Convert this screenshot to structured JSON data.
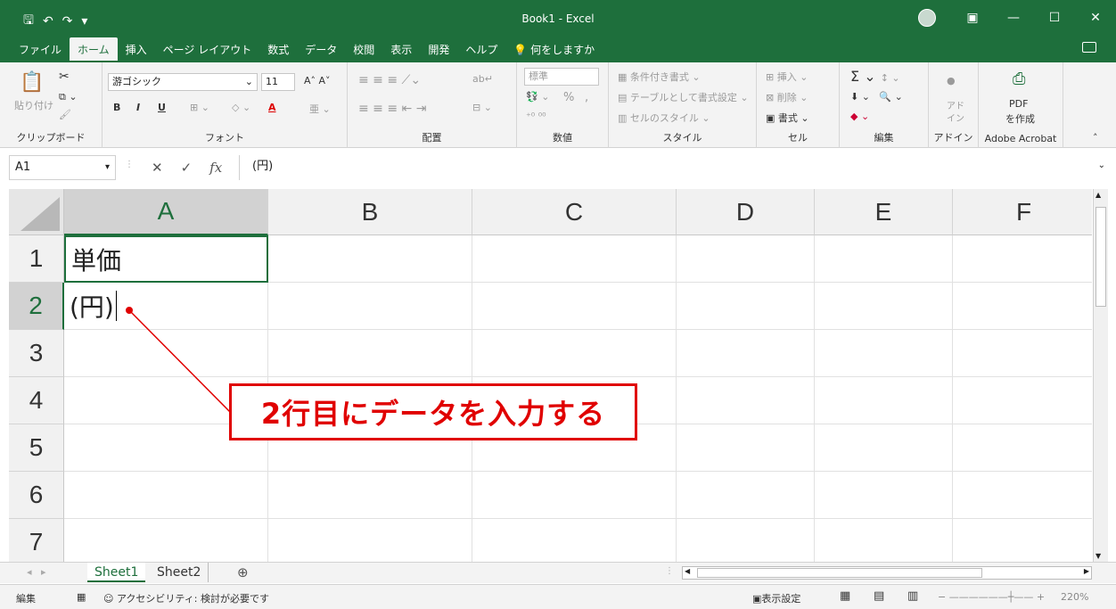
{
  "window": {
    "title": "Book1  -  Excel",
    "controls": [
      "ribbon-display",
      "minimize",
      "maximize",
      "close"
    ]
  },
  "qat": {
    "save": "🖫",
    "undo": "↶",
    "redo": "↷",
    "more": "▾"
  },
  "tabs": [
    "ファイル",
    "ホーム",
    "挿入",
    "ページ レイアウト",
    "数式",
    "データ",
    "校閲",
    "表示",
    "開発",
    "ヘルプ"
  ],
  "active_tab": "ホーム",
  "tell_me": "何をしますか",
  "ribbon": {
    "clipboard": {
      "label": "クリップボード",
      "paste": "貼り付け"
    },
    "font": {
      "label": "フォント",
      "name": "游ゴシック",
      "size": "11",
      "bold": "B",
      "italic": "I",
      "underline": "U"
    },
    "alignment": {
      "label": "配置"
    },
    "number": {
      "label": "数値",
      "format": "標準",
      "percent": "%",
      "comma": ","
    },
    "styles": {
      "label": "スタイル",
      "cond": "条件付き書式",
      "table": "テーブルとして書式設定",
      "cell": "セルのスタイル"
    },
    "cells": {
      "label": "セル",
      "insert": "挿入",
      "delete": "削除",
      "format": "書式"
    },
    "editing": {
      "label": "編集",
      "sum": "Σ"
    },
    "addins": {
      "label": "アドイン",
      "btn1": "アド",
      "btn2": "イン"
    },
    "acrobat": {
      "label": "Adobe Acrobat",
      "btn1": "PDF",
      "btn2": "を作成"
    }
  },
  "formula_bar": {
    "name_box": "A1",
    "content": "(円)",
    "cancel": "✕",
    "enter": "✓",
    "fx": "fx"
  },
  "columns": [
    "A",
    "B",
    "C",
    "D",
    "E",
    "F"
  ],
  "rows": [
    "1",
    "2",
    "3",
    "4",
    "5",
    "6",
    "7"
  ],
  "cells": {
    "A1": "単価",
    "A2": "(円)"
  },
  "sheets": [
    "Sheet1",
    "Sheet2"
  ],
  "active_sheet": "Sheet1",
  "status": {
    "mode": "編集",
    "accessibility": "アクセシビリティ: 検討が必要です",
    "display_settings": "表示設定",
    "zoom": "220%"
  },
  "annotation": {
    "text": "2行目にデータを入力する",
    "color": "#e00000"
  },
  "colors": {
    "brand": "#1e6f3c",
    "ribbon_bg": "#f3f3f3"
  }
}
